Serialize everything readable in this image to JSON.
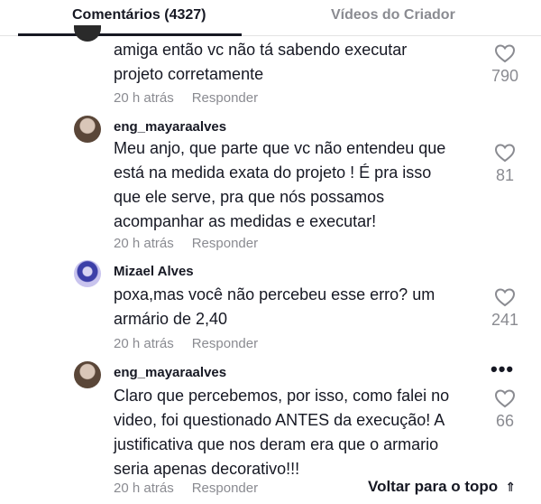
{
  "tabs": [
    {
      "label": "Comentários (4327)",
      "active": true
    },
    {
      "label": "Vídeos do Criador",
      "active": false
    }
  ],
  "comments": [
    {
      "username": "",
      "lines": [
        "amiga então vc não tá sabendo executar",
        "projeto corretamente"
      ],
      "time": "20 h atrás",
      "reply_label": "Responder",
      "likes": "790"
    },
    {
      "username": "eng_mayaraalves",
      "lines": [
        "Meu anjo, que parte que vc não entendeu que",
        "está na medida exata do projeto ! É pra isso",
        "que ele serve, pra que nós possamos",
        "acompanhar as medidas e executar!"
      ],
      "time": "20 h atrás",
      "reply_label": "Responder",
      "likes": "81"
    },
    {
      "username": "Mizael Alves",
      "lines": [
        "poxa,mas você não percebeu esse erro? um",
        "armário de 2,40"
      ],
      "time": "20 h atrás",
      "reply_label": "Responder",
      "likes": "241"
    },
    {
      "username": "eng_mayaraalves",
      "lines": [
        "Claro que percebemos, por isso, como falei no",
        "video, foi questionado ANTES da execução! A",
        "justificativa que nos deram era que o armario",
        "seria apenas decorativo!!!"
      ],
      "time": "20 h atrás",
      "reply_label": "Responder",
      "likes": "66"
    }
  ],
  "more_options": "•••",
  "back_to_top": {
    "label": "Voltar para o topo",
    "icon": "double-chevron-up-icon"
  },
  "colors": {
    "text": "#161823",
    "muted": "#8a8b91",
    "divider": "#e3e3e4"
  }
}
